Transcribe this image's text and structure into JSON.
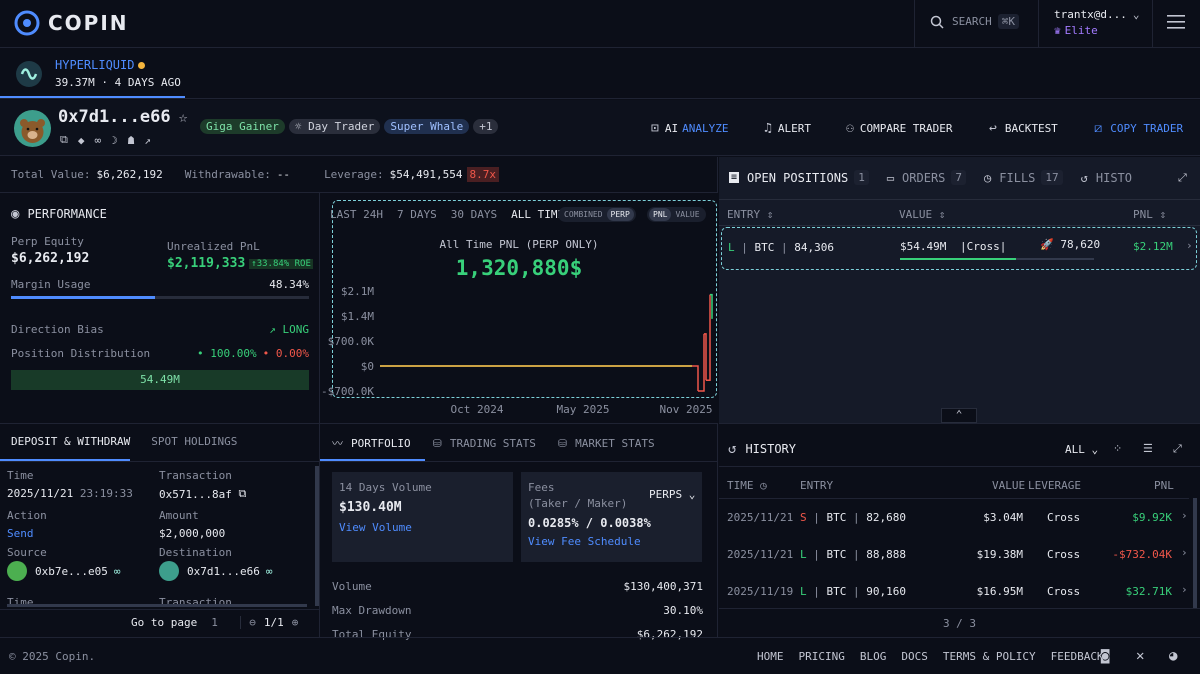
{
  "header": {
    "brand": "COPIN",
    "search_label": "SEARCH",
    "search_shortcut": "⌘K",
    "user_name": "trantx@d...",
    "user_tier": "Elite"
  },
  "exchange": {
    "name": "HYPERLIQUID",
    "sub": "39.37M · 4 DAYS AGO"
  },
  "trader": {
    "address": "0x7d1...e66",
    "tags": [
      "Giga Gainer",
      "Day Trader",
      "Super Whale"
    ],
    "more": "+1",
    "actions": {
      "ai": "AI",
      "analyze": "ANALYZE",
      "alert": "ALERT",
      "compare": "COMPARE TRADER",
      "backtest": "BACKTEST",
      "copy": "COPY TRADER"
    }
  },
  "stats": {
    "total_label": "Total Value:",
    "total": "$6,262,192",
    "withdraw_label": "Withdrawable:",
    "withdraw": "--",
    "lev_label": "Leverage:",
    "lev": "$54,491,554",
    "lev_x": "8.7x"
  },
  "performance": {
    "title": "PERFORMANCE",
    "equity_label": "Perp Equity",
    "equity": "$6,262,192",
    "upnl_label": "Unrealized PnL",
    "upnl": "$2,119,333",
    "roe": "↑33.84% ROE",
    "margin_label": "Margin Usage",
    "margin": "48.34%",
    "margin_frac": 0.4834,
    "bias_label": "Direction Bias",
    "bias": "LONG",
    "dist_label": "Position Distribution",
    "dist_long": "100.00%",
    "dist_short": "0.00%",
    "bar_value": "54.49M"
  },
  "chart": {
    "ranges": [
      "LAST 24H",
      "7 DAYS",
      "30 DAYS",
      "ALL TIME"
    ],
    "toggle1": [
      "COMBINED",
      "PERP"
    ],
    "toggle2": [
      "PNL",
      "VALUE"
    ],
    "subtitle": "All Time PNL (PERP ONLY)",
    "value": "1,320,880$"
  },
  "chart_data": {
    "type": "line",
    "title": "All Time PNL (PERP ONLY)",
    "y_ticks": [
      "$2.1M",
      "$1.4M",
      "$700.0K",
      "$0",
      "-$700.0K"
    ],
    "x_ticks": [
      "Oct 2024",
      "May 2025",
      "Nov 2025"
    ],
    "ylim": [
      -700000,
      2100000
    ],
    "x": [
      "2024-03",
      "2024-10",
      "2025-05",
      "2025-10",
      "2025-10",
      "2025-11",
      "2025-11",
      "2025-11",
      "2025-11"
    ],
    "values": [
      0,
      0,
      0,
      0,
      -700000,
      900000,
      -400000,
      2000000,
      1320880
    ]
  },
  "positions": {
    "tabs": [
      {
        "label": "OPEN POSITIONS",
        "count": "1"
      },
      {
        "label": "ORDERS",
        "count": "7"
      },
      {
        "label": "FILLS",
        "count": "17"
      },
      {
        "label": "HISTO"
      }
    ],
    "cols": [
      "ENTRY",
      "VALUE",
      "PNL"
    ],
    "rows": [
      {
        "side": "L",
        "coin": "BTC",
        "entry": "84,306",
        "value": "$54.49M",
        "mode": "Cross",
        "liq": "78,620",
        "pnl": "$2.12M"
      }
    ]
  },
  "deposit": {
    "tabs": [
      "DEPOSIT & WITHDRAW",
      "SPOT HOLDINGS"
    ],
    "time_label": "Time",
    "time": "2025/11/21",
    "time2": "23:19:33",
    "tx_label": "Transaction",
    "tx": "0x571...8af",
    "action_label": "Action",
    "action": "Send",
    "amount_label": "Amount",
    "amount": "$2,000,000",
    "source_label": "Source",
    "source": "0xb7e...e05",
    "dest_label": "Destination",
    "dest": "0x7d1...e66",
    "goto": "Go to page",
    "page": "1",
    "pages": "1/1"
  },
  "portfolio": {
    "tabs": [
      "PORTFOLIO",
      "TRADING STATS",
      "MARKET STATS"
    ],
    "vol14_label": "14 Days Volume",
    "vol14": "$130.40M",
    "vol_link": "View Volume",
    "fees_label": "Fees",
    "fees_sub": "(Taker / Maker)",
    "fees": "0.0285% / 0.0038%",
    "fees_link": "View Fee Schedule",
    "fees_type": "PERPS",
    "rows": [
      {
        "k": "Volume",
        "v": "$130,400,371"
      },
      {
        "k": "Max Drawdown",
        "v": "30.10%"
      },
      {
        "k": "Total Equity",
        "v": "$6,262,192"
      }
    ]
  },
  "history": {
    "title": "HISTORY",
    "filter": "ALL",
    "cols": [
      "TIME",
      "ENTRY",
      "VALUE",
      "LEVERAGE",
      "PNL"
    ],
    "rows": [
      {
        "time": "2025/11/21",
        "side": "S",
        "coin": "BTC",
        "entry": "82,680",
        "value": "$3.04M",
        "lev": "Cross",
        "pnl": "$9.92K",
        "pos": true
      },
      {
        "time": "2025/11/21",
        "side": "L",
        "coin": "BTC",
        "entry": "88,888",
        "value": "$19.38M",
        "lev": "Cross",
        "pnl": "-$732.04K",
        "pos": false
      },
      {
        "time": "2025/11/19",
        "side": "L",
        "coin": "BTC",
        "entry": "90,160",
        "value": "$16.95M",
        "lev": "Cross",
        "pnl": "$32.71K",
        "pos": true
      }
    ],
    "page": "3 / 3"
  },
  "footer": {
    "copy": "© 2025 Copin.",
    "links": [
      "HOME",
      "PRICING",
      "BLOG",
      "DOCS",
      "TERMS & POLICY",
      "FEEDBACK"
    ]
  }
}
